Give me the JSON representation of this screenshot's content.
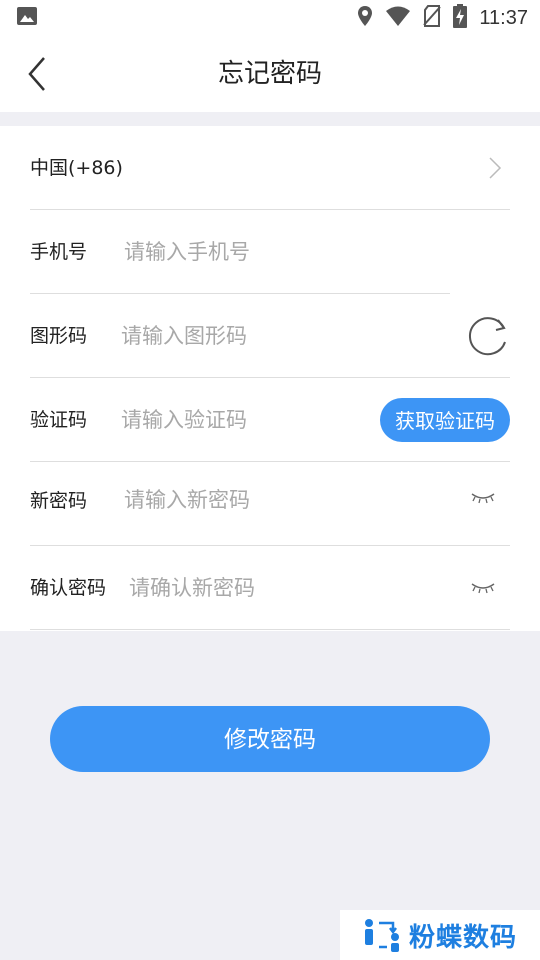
{
  "status_bar": {
    "time": "11:37"
  },
  "header": {
    "title": "忘记密码"
  },
  "form": {
    "country": "中国(+86)",
    "phone": {
      "label": "手机号",
      "placeholder": "请输入手机号"
    },
    "captcha": {
      "label": "图形码",
      "placeholder": "请输入图形码"
    },
    "sms_code": {
      "label": "验证码",
      "placeholder": "请输入验证码",
      "button_label": "获取验证码"
    },
    "new_password": {
      "label": "新密码",
      "placeholder": "请输入新密码"
    },
    "confirm_password": {
      "label": "确认密码",
      "placeholder": "请确认新密码"
    }
  },
  "submit_label": "修改密码",
  "watermark": {
    "text": "粉蝶数码"
  },
  "colors": {
    "accent": "#3d95f5",
    "background": "#efeff4"
  }
}
